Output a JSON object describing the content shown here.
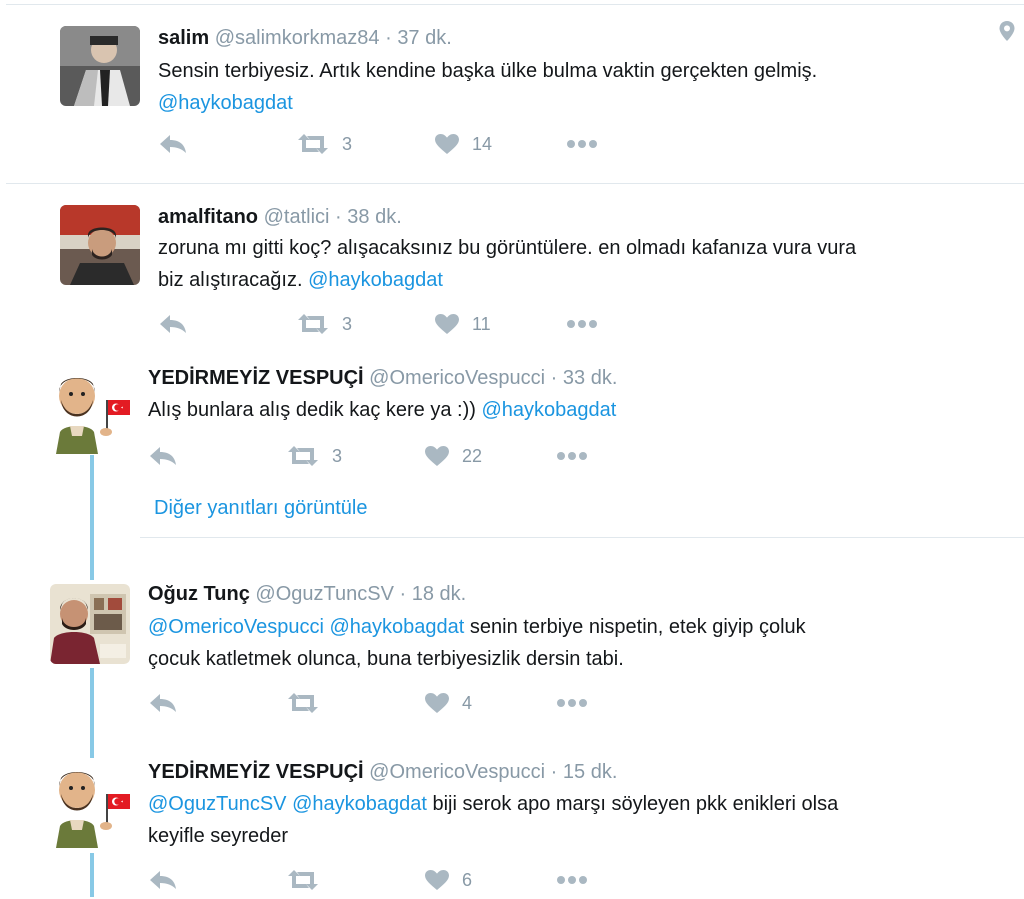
{
  "tweets": [
    {
      "name": "salim",
      "handle": "@salimkorkmaz84",
      "time": "37 dk.",
      "text_plain": "Sensin terbiyesiz. Artık  kendine başka ülke bulma vaktin gerçekten gelmiş.",
      "text_mention_end": "@haykobagdat",
      "retweets": "3",
      "likes": "14"
    },
    {
      "name": "amalfitano",
      "handle": "@tatlici",
      "time": "38 dk.",
      "text_line1": "zoruna mı gitti koç? alışacaksınız bu görüntülere. en olmadı kafanıza vura vura",
      "text_line2": "biz alıştıracağız.",
      "text_mention_end": "@haykobagdat",
      "retweets": "3",
      "likes": "11"
    },
    {
      "name": "YEDİRMEYİZ VESPUÇİ",
      "handle": "@OmericoVespucci",
      "time": "33 dk.",
      "text_plain": "Alış bunlara alış dedik kaç kere ya :))",
      "text_mention_end": "@haykobagdat",
      "retweets": "3",
      "likes": "22"
    },
    {
      "name": "Oğuz Tunç",
      "handle": "@OguzTuncSV",
      "time": "18 dk.",
      "mention1": "@OmericoVespucci",
      "mention2": "@haykobagdat",
      "text_line1_rest": "senin terbiye nispetin, etek giyip çoluk",
      "text_line2": "çocuk katletmek olunca, buna terbiyesizlik dersin tabi.",
      "likes": "4"
    },
    {
      "name": "YEDİRMEYİZ VESPUÇİ",
      "handle": "@OmericoVespucci",
      "time": "15 dk.",
      "mention1": "@OguzTuncSV",
      "mention2": "@haykobagdat",
      "text_line1_rest": "biji serok apo marşı söyleyen pkk enikleri olsa",
      "text_line2": "keyifle seyreder",
      "likes": "6"
    }
  ],
  "sep": "·",
  "more_replies": "Diğer yanıtları görüntüle",
  "colors": {
    "link": "#1b95e0",
    "icon": "#aab8c2",
    "thread": "#88c9e6",
    "muted": "#8899a6"
  }
}
